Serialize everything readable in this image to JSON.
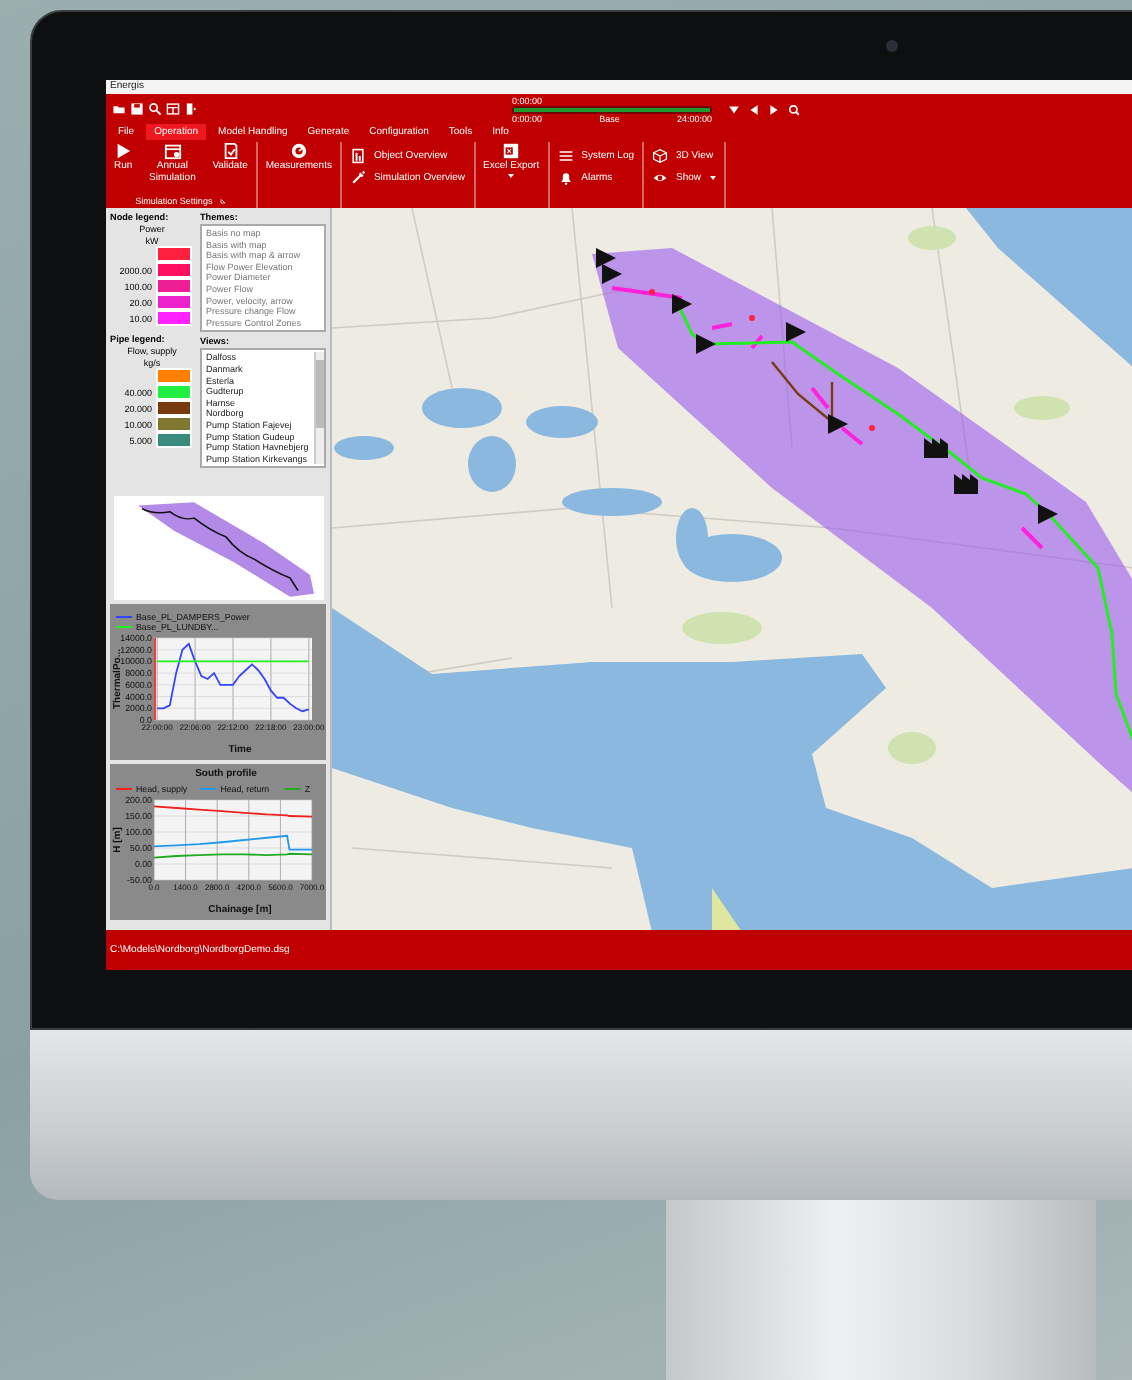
{
  "window": {
    "title": "Energis"
  },
  "timeline": {
    "time": "0:00:00",
    "level": 1,
    "ticks": [
      "0:00:00",
      "Base",
      "24:00:00"
    ]
  },
  "ribbon": {
    "tabs": [
      {
        "label": "File",
        "selected": false
      },
      {
        "label": "Operation",
        "selected": true
      },
      {
        "label": "Model Handling",
        "selected": false
      },
      {
        "label": "Generate",
        "selected": false
      },
      {
        "label": "Configuration",
        "selected": false
      },
      {
        "label": "Tools",
        "selected": false
      },
      {
        "label": "Info",
        "selected": false
      }
    ],
    "groups": [
      {
        "label": "Simulation Settings",
        "buttons": [
          {
            "kind": "large",
            "label": "Run",
            "dropdown": false
          },
          {
            "kind": "large",
            "label": "Annual Simulation",
            "dropdown": false
          },
          {
            "kind": "large",
            "label": "Validate",
            "dropdown": false
          }
        ]
      },
      {
        "buttons": [
          {
            "kind": "large",
            "label": "Measurements",
            "dropdown": false
          }
        ]
      },
      {
        "buttons": [
          {
            "kind": "small",
            "label": "Object Overview",
            "dropdown": false
          },
          {
            "kind": "small",
            "label": "Simulation Overview",
            "dropdown": false
          }
        ]
      },
      {
        "buttons": [
          {
            "kind": "large",
            "label": "Excel Export",
            "dropdown": true
          }
        ]
      },
      {
        "buttons": [
          {
            "kind": "small",
            "label": "System Log",
            "dropdown": false
          },
          {
            "kind": "small",
            "label": "Alarms",
            "dropdown": false
          }
        ]
      },
      {
        "buttons": [
          {
            "kind": "small",
            "label": "3D View",
            "dropdown": false
          },
          {
            "kind": "small",
            "label": "Show",
            "dropdown": true
          }
        ]
      }
    ]
  },
  "node_legend": {
    "title": "Node legend:",
    "quantity": "Power",
    "unit": "kW",
    "items": [
      {
        "color": "#ff2040"
      },
      {
        "label": "2000.00",
        "color": "#ff1060"
      },
      {
        "label": "100.00",
        "color": "#f01e96"
      },
      {
        "label": "20.00",
        "color": "#ee22cc"
      },
      {
        "label": "10.00",
        "color": "#ff22ff"
      }
    ]
  },
  "pipe_legend": {
    "title": "Pipe legend:",
    "quantity": "Flow, supply",
    "unit": "kg/s",
    "items": [
      {
        "color": "#ff8000"
      },
      {
        "label": "40.000",
        "color": "#22ee44"
      },
      {
        "label": "20.000",
        "color": "#7a3a10"
      },
      {
        "label": "10.000",
        "color": "#807830"
      },
      {
        "label": "5.000",
        "color": "#3a8a80"
      }
    ]
  },
  "themes": {
    "title": "Themes:",
    "items": [
      "Basis no map",
      "Basis with map",
      "Basis with map & arrow",
      "Flow Power Elevation",
      "Power Diameter",
      "Power Flow",
      "Power, velocity, arrow",
      "Pressure change Flow",
      "Pressure Control Zones"
    ]
  },
  "views": {
    "title": "Views:",
    "items": [
      "Dalfoss",
      "Danmark",
      "Esterla",
      "Gudterup",
      "Harnse",
      "Nordborg",
      "Pump Station Fajevej",
      "Pump Station Gudeup",
      "Pump Station Havnebjerg",
      "Pump Station Kirkevangs"
    ]
  },
  "charts": [
    {
      "chart_data": {
        "type": "line",
        "xlabel": "Time",
        "ylabel": "ThermalPo...",
        "grid": true,
        "legend": "top",
        "categories": [
          "22:00:00",
          null,
          null,
          null,
          null,
          null,
          "22:06:00",
          null,
          null,
          null,
          null,
          null,
          "22:12:00",
          null,
          null,
          null,
          null,
          null,
          "22:18:00",
          null,
          null,
          null,
          null,
          null,
          "23:00:00"
        ],
        "series": [
          {
            "name": "Base_PL_DAMPERS_Power",
            "color": "#3344ff",
            "values": [
              2000,
              2000,
              2500,
              8000,
              12000,
              13000,
              10000,
              7500,
              7000,
              8000,
              6000,
              6000,
              6000,
              7500,
              8500,
              9500,
              8500,
              7000,
              5000,
              3800,
              3800,
              2800,
              2000,
              1500,
              1800
            ]
          },
          {
            "name": "Base_PL_LUNDBY...",
            "color": "#22ee22",
            "values": [
              10000,
              10000,
              10000,
              10000,
              10000,
              10000,
              10000,
              10000,
              10000,
              10000,
              10000,
              10000,
              10000,
              10000,
              10000,
              10000,
              10000,
              10000,
              10000,
              10000,
              10000,
              10000,
              10000,
              10000,
              10000
            ]
          }
        ],
        "ylim": [
          0,
          14000
        ],
        "yticks": [
          {
            "value": 0,
            "label": "0.0"
          },
          {
            "value": 2000,
            "label": "2000.0"
          },
          {
            "value": 4000,
            "label": "4000.0"
          },
          {
            "value": 6000,
            "label": "6000.0"
          },
          {
            "value": 8000,
            "label": "8000.0"
          },
          {
            "value": 10000,
            "label": "10000.0"
          },
          {
            "value": 12000,
            "label": "12000.0"
          },
          {
            "value": 14000,
            "label": "14000.0"
          }
        ]
      }
    },
    {
      "chart_data": {
        "type": "line",
        "title": "South profile",
        "xlabel": "Chainage [m]",
        "ylabel": "H [m]",
        "grid": true,
        "legend": "top",
        "x": [
          0,
          1000,
          2000,
          3000,
          4000,
          5000,
          5900,
          6000,
          7000
        ],
        "series": [
          {
            "name": "Head, supply",
            "color": "#ee2222",
            "values": [
              180,
              175,
              170,
              165,
              160,
              155,
              152,
              150,
              148
            ]
          },
          {
            "name": "Head, return",
            "color": "#2299ee",
            "values": [
              55,
              58,
              62,
              68,
              75,
              82,
              88,
              45,
              45
            ]
          },
          {
            "name": "Z",
            "color": "#22aa22",
            "values": [
              20,
              25,
              28,
              30,
              30,
              28,
              30,
              32,
              30
            ]
          }
        ],
        "xlim": [
          0,
          7000
        ],
        "ylim": [
          -50,
          200
        ],
        "xticks": [
          {
            "value": 0,
            "label": "0.0"
          },
          {
            "value": 1400,
            "label": "1400.0"
          },
          {
            "value": 2800,
            "label": "2800.0"
          },
          {
            "value": 4200,
            "label": "4200.0"
          },
          {
            "value": 5600,
            "label": "5600.0"
          },
          {
            "value": 7000,
            "label": "7000.0"
          }
        ],
        "yticks": [
          {
            "value": -50,
            "label": "-50.00"
          },
          {
            "value": 0,
            "label": "0.00"
          },
          {
            "value": 50,
            "label": "50.00"
          },
          {
            "value": 100,
            "label": "100.00"
          },
          {
            "value": 150,
            "label": "150.00"
          },
          {
            "value": 200,
            "label": "200.00"
          }
        ]
      }
    }
  ],
  "status_bar": {
    "path": "C:\\Models\\Nordborg\\NordborgDemo.dsg"
  }
}
